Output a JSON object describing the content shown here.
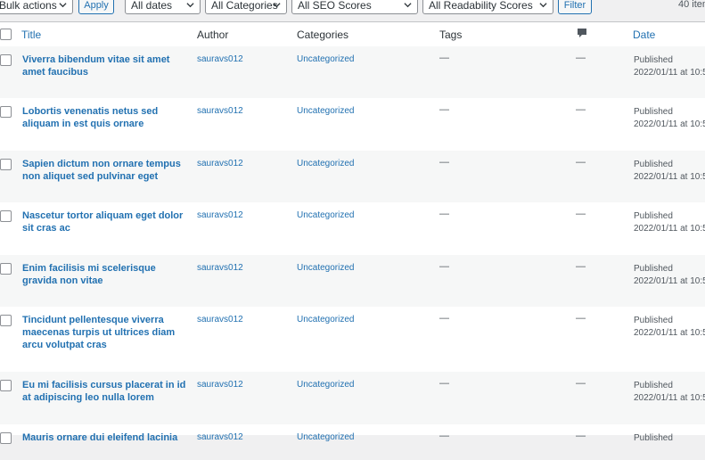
{
  "filters": {
    "bulk_actions": "Bulk actions",
    "apply": "Apply",
    "dates": "All dates",
    "categories": "All Categories",
    "seo_scores": "All SEO Scores",
    "readability_scores": "All Readability Scores",
    "filter": "Filter",
    "item_count": "40 item"
  },
  "columns": {
    "title": "Title",
    "author": "Author",
    "categories": "Categories",
    "tags": "Tags",
    "comments_icon": "comment-bubble-icon",
    "date": "Date"
  },
  "rows": [
    {
      "title": "Viverra bibendum vitae sit amet amet faucibus",
      "author": "sauravs012",
      "category": "Uncategorized",
      "tags": "—",
      "comments": "—",
      "status": "Published",
      "date": "2022/01/11 at 10:5"
    },
    {
      "title": "Lobortis venenatis netus sed aliquam in est quis ornare",
      "author": "sauravs012",
      "category": "Uncategorized",
      "tags": "—",
      "comments": "—",
      "status": "Published",
      "date": "2022/01/11 at 10:5"
    },
    {
      "title": "Sapien dictum non ornare tempus non aliquet sed pulvinar eget",
      "author": "sauravs012",
      "category": "Uncategorized",
      "tags": "—",
      "comments": "—",
      "status": "Published",
      "date": "2022/01/11 at 10:5"
    },
    {
      "title": "Nascetur tortor aliquam eget dolor sit cras ac",
      "author": "sauravs012",
      "category": "Uncategorized",
      "tags": "—",
      "comments": "—",
      "status": "Published",
      "date": "2022/01/11 at 10:5"
    },
    {
      "title": "Enim facilisis mi scelerisque gravida non vitae",
      "author": "sauravs012",
      "category": "Uncategorized",
      "tags": "—",
      "comments": "—",
      "status": "Published",
      "date": "2022/01/11 at 10:5"
    },
    {
      "title": "Tincidunt pellentesque viverra maecenas turpis ut ultrices diam arcu volutpat cras",
      "author": "sauravs012",
      "category": "Uncategorized",
      "tags": "—",
      "comments": "—",
      "status": "Published",
      "date": "2022/01/11 at 10:5"
    },
    {
      "title": "Eu mi facilisis cursus placerat in id at adipiscing leo nulla lorem",
      "author": "sauravs012",
      "category": "Uncategorized",
      "tags": "—",
      "comments": "—",
      "status": "Published",
      "date": "2022/01/11 at 10:5"
    },
    {
      "title": "Mauris ornare dui eleifend lacinia",
      "author": "sauravs012",
      "category": "Uncategorized",
      "tags": "—",
      "comments": "—",
      "status": "Published",
      "date": ""
    }
  ]
}
